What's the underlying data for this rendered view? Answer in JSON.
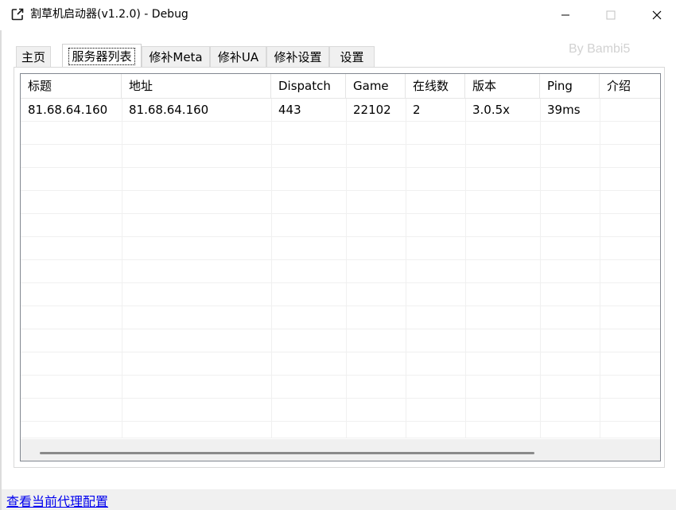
{
  "window": {
    "title": "割草机启动器(v1.2.0) - Debug",
    "watermark": "By Bambi5"
  },
  "tabs": [
    {
      "label": "主页"
    },
    {
      "label": "服务器列表",
      "active": true
    },
    {
      "label": "修补Meta"
    },
    {
      "label": "修补UA"
    },
    {
      "label": "修补设置"
    },
    {
      "label": "设置"
    }
  ],
  "server_list": {
    "columns": [
      "标题",
      "地址",
      "Dispatch",
      "Game",
      "在线数",
      "版本",
      "Ping",
      "介绍"
    ],
    "rows": [
      [
        "81.68.64.160",
        "81.68.64.160",
        "443",
        "22102",
        "2",
        "3.0.5x",
        "39ms",
        ""
      ]
    ]
  },
  "footer": {
    "proxy_link": "查看当前代理配置"
  }
}
